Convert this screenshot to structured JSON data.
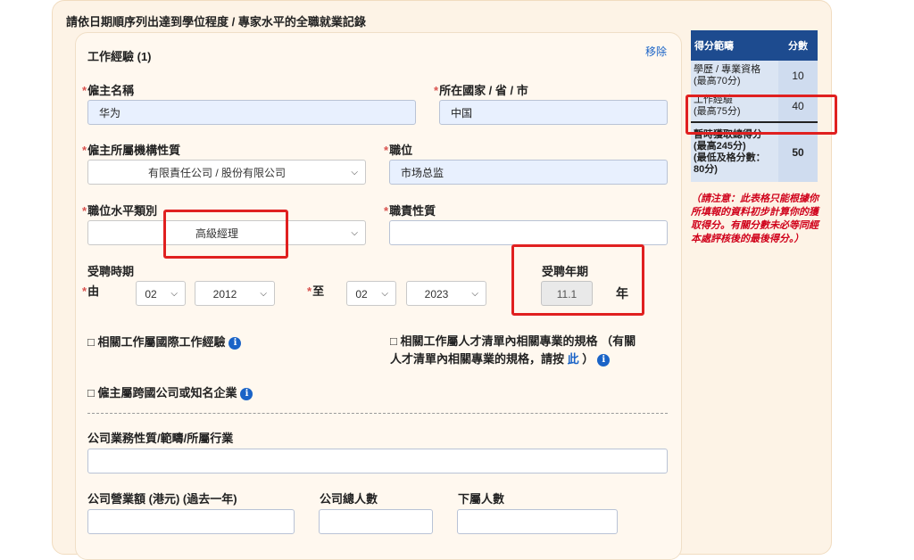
{
  "section_title": "請依日期順序列出達到學位程度 / 專家水平的全職就業記錄",
  "card": {
    "title": "工作經驗 (1)",
    "remove_label": "移除"
  },
  "required_mark": "*",
  "fields": {
    "employer_name": {
      "label": "僱主名稱",
      "value": "华为"
    },
    "location": {
      "label": "所在國家 / 省 / 市",
      "value": "中国"
    },
    "org_nature": {
      "label": "僱主所屬機構性質",
      "value": "有限責任公司 / 股份有限公司"
    },
    "position": {
      "label": "職位",
      "value": "市场总监"
    },
    "position_level": {
      "label": "職位水平類別",
      "value": "高級經理"
    },
    "duty_nature": {
      "label": "職責性質",
      "value": ""
    }
  },
  "employment_period": {
    "label": "受聘時期",
    "from_label": "由",
    "to_label": "至",
    "from_month": "02",
    "from_year": "2012",
    "to_month": "02",
    "to_year": "2023"
  },
  "employment_years": {
    "label": "受聘年期",
    "value": "11.1",
    "unit": "年"
  },
  "checkboxes": {
    "international": "□ 相關工作屬國際工作經驗",
    "talent_list_line1": "□ 相關工作屬人才清單內相關專業的規格 （有關",
    "talent_list_line2": "人才清單內相關專業的規格，請按",
    "talent_list_link": "此",
    "talent_list_end": "）",
    "multinational": "□ 僱主屬跨國公司或知名企業"
  },
  "company": {
    "business_label": "公司業務性質/範疇/所屬行業",
    "business_value": "",
    "turnover_label": "公司營業額 (港元) (過去一年)",
    "turnover_value": "",
    "staff_label": "公司總人數",
    "staff_value": "",
    "subordinates_label": "下屬人數",
    "subordinates_value": ""
  },
  "score_table": {
    "headers": [
      "得分範疇",
      "分數"
    ],
    "rows": [
      {
        "category": "學歷 / 專業資格",
        "sub": "(最高70分)",
        "score": "10"
      },
      {
        "category": "工作經驗",
        "sub": "(最高75分)",
        "score": "40"
      },
      {
        "category": "暫時獲取總得分",
        "sub": "(最高245分)",
        "extra": "(最低及格分數：80分)",
        "score": "50"
      }
    ],
    "note": "（請注意：此表格只能根據你所填報的資料初步計算你的獲取得分。有關分數未必等同經本處評核後的最後得分。）"
  },
  "colors": {
    "header_bg": "#1d4b8f",
    "highlight_red": "#e02020",
    "link_blue": "#1a63c7",
    "note_red": "#d0021b"
  }
}
